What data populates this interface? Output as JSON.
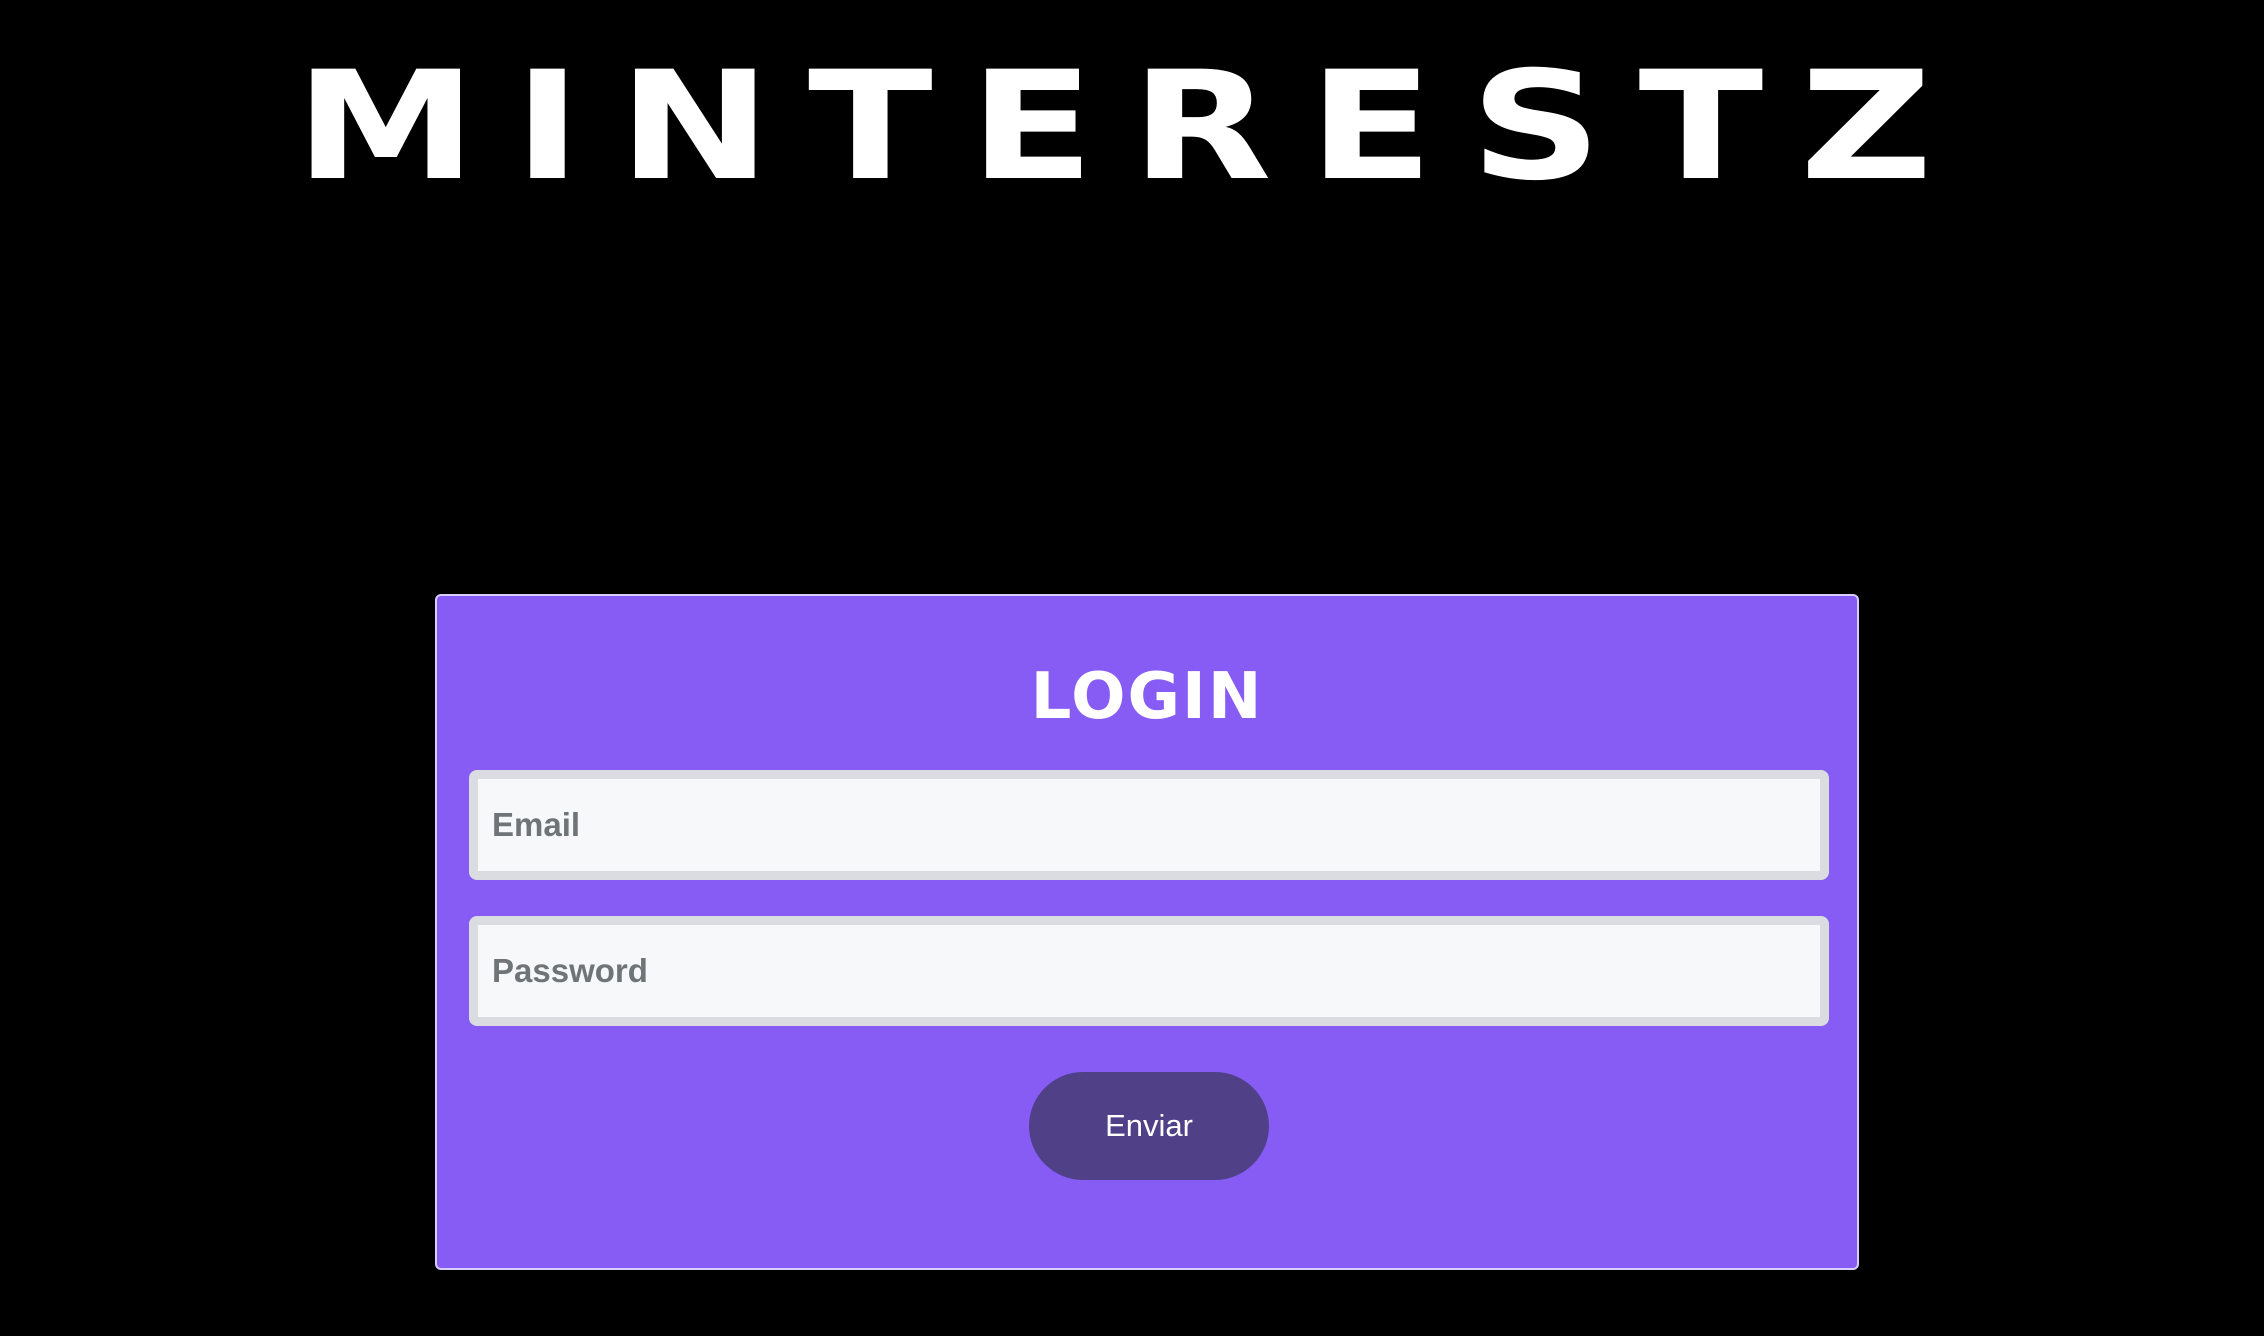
{
  "header": {
    "brand": "MINTERESTZ"
  },
  "login_form": {
    "title": "LOGIN",
    "email_placeholder": "Email",
    "email_value": "",
    "password_placeholder": "Password",
    "password_value": "",
    "submit_label": "Enviar"
  },
  "colors": {
    "background": "#000000",
    "card": "#865cf5",
    "button": "#504088",
    "input_fill": "#f6f8fa",
    "input_border": "#dadce2"
  }
}
